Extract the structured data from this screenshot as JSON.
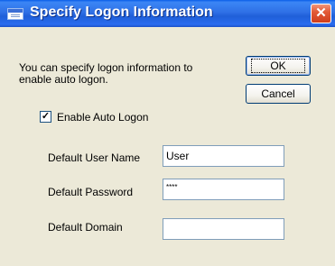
{
  "window": {
    "title": "Specify Logon Information",
    "close_label": "✕"
  },
  "dialog": {
    "description": "You can specify logon information to enable auto logon.",
    "ok_label": "OK",
    "cancel_label": "Cancel",
    "auto_logon": {
      "label": "Enable Auto Logon",
      "checked": true,
      "check_mark": "✓"
    },
    "fields": {
      "user_name": {
        "label": "Default User Name",
        "value": "User"
      },
      "password": {
        "label": "Default Password",
        "value": "****"
      },
      "domain": {
        "label": "Default Domain",
        "value": ""
      }
    }
  },
  "colors": {
    "titlebar": "#2f70e6",
    "window_body": "#ece9d8",
    "close_button": "#e25a37"
  }
}
